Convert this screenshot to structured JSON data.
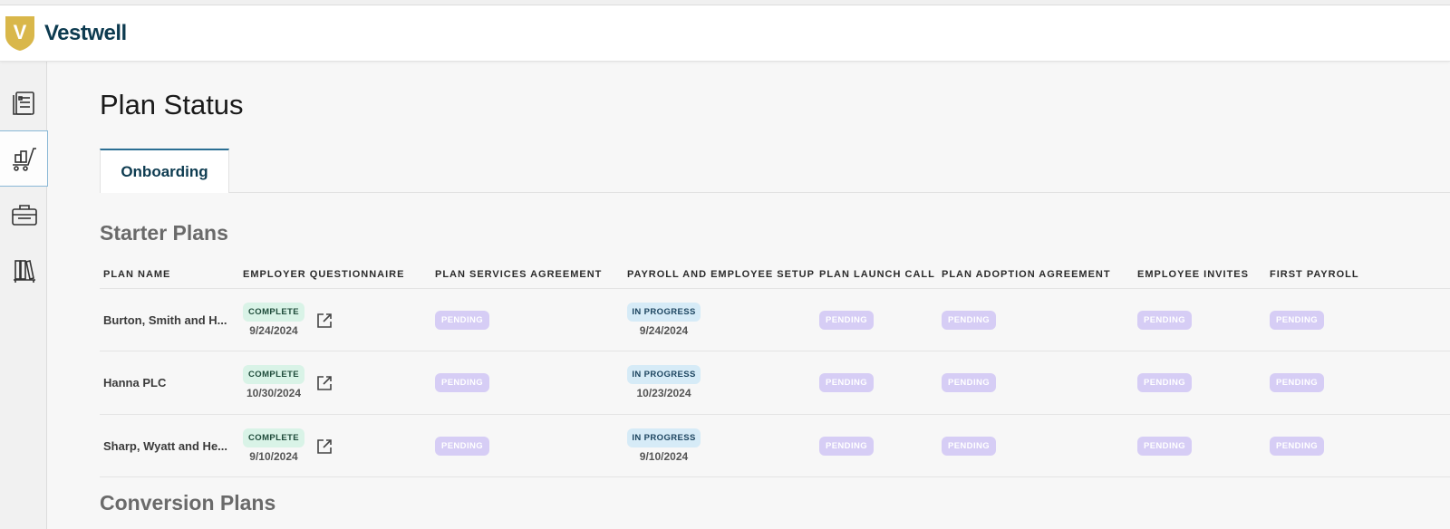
{
  "brand": {
    "name": "Vestwell",
    "logo_letter": "V",
    "color_primary": "#0d3b50",
    "color_logo": "#d9b74a"
  },
  "sidebar": {
    "items": [
      {
        "name": "document-list-icon",
        "active": false
      },
      {
        "name": "plan-cart-icon",
        "active": true
      },
      {
        "name": "briefcase-icon",
        "active": false
      },
      {
        "name": "library-icon",
        "active": false
      }
    ]
  },
  "page": {
    "title": "Plan Status"
  },
  "tabs": [
    {
      "label": "Onboarding",
      "active": true
    }
  ],
  "starter": {
    "title": "Starter Plans",
    "columns": [
      "PLAN NAME",
      "EMPLOYER QUESTIONNAIRE",
      "PLAN SERVICES AGREEMENT",
      "PAYROLL AND EMPLOYEE SETUP",
      "PLAN LAUNCH CALL",
      "PLAN ADOPTION AGREEMENT",
      "EMPLOYEE INVITES",
      "FIRST PAYROLL"
    ],
    "rows": [
      {
        "name": "Burton, Smith and H...",
        "questionnaire": {
          "status": "COMPLETE",
          "date": "9/24/2024"
        },
        "services": "PENDING",
        "payroll": {
          "status": "IN PROGRESS",
          "date": "9/24/2024"
        },
        "launch": "PENDING",
        "adoption": "PENDING",
        "invites": "PENDING",
        "first_payroll": "PENDING"
      },
      {
        "name": "Hanna PLC",
        "questionnaire": {
          "status": "COMPLETE",
          "date": "10/30/2024"
        },
        "services": "PENDING",
        "payroll": {
          "status": "IN PROGRESS",
          "date": "10/23/2024"
        },
        "launch": "PENDING",
        "adoption": "PENDING",
        "invites": "PENDING",
        "first_payroll": "PENDING"
      },
      {
        "name": "Sharp, Wyatt and He...",
        "questionnaire": {
          "status": "COMPLETE",
          "date": "9/10/2024"
        },
        "services": "PENDING",
        "payroll": {
          "status": "IN PROGRESS",
          "date": "9/10/2024"
        },
        "launch": "PENDING",
        "adoption": "PENDING",
        "invites": "PENDING",
        "first_payroll": "PENDING"
      }
    ]
  },
  "conversion": {
    "title": "Conversion Plans"
  },
  "colors": {
    "complete_bg": "#d9f3e7",
    "inprogress_bg": "#d6ebf7",
    "pending_bg": "#d6cdf5",
    "tab_accent": "#2b6e93"
  }
}
